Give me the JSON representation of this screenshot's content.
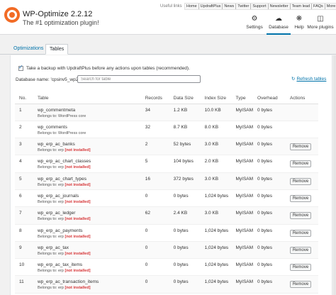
{
  "header": {
    "title": "WP-Optimize 2.2.12",
    "subtitle": "The #1 optimization plugin!",
    "useful_links_label": "Useful links",
    "top_links": [
      "Home",
      "UpdraftPlus",
      "News",
      "Twitter",
      "Support",
      "Newsletter",
      "Team lead",
      "FAQs",
      "More plugins"
    ],
    "nav": {
      "settings": "Settings",
      "database": "Database",
      "help": "Help",
      "more_plugins": "More plugins"
    }
  },
  "tabs": {
    "optimizations": "Optimizations",
    "tables": "Tables"
  },
  "backup_label": "Take a backup with UpdraftPlus before any actions upon tables (recommended).",
  "db_name_label": "Database name: 'cpsinv5_wp226'",
  "search": {
    "placeholder": "Search for table"
  },
  "refresh_label": "Refresh tables",
  "table": {
    "headers": {
      "no": "No.",
      "table": "Table",
      "records": "Records",
      "data_size": "Data Size",
      "index_size": "Index Size",
      "type": "Type",
      "overhead": "Overhead",
      "actions": "Actions"
    },
    "remove_label": "Remove",
    "rows": [
      {
        "no": "1",
        "name": "wp_commentmeta",
        "belongs": "Belongs to: WordPress core",
        "not_installed": "",
        "records": "34",
        "data_size": "1.2 KB",
        "index_size": "10.0 KB",
        "type": "MyISAM",
        "overhead": "0 bytes",
        "removable": false
      },
      {
        "no": "2",
        "name": "wp_comments",
        "belongs": "Belongs to: WordPress core",
        "not_installed": "",
        "records": "32",
        "data_size": "8.7 KB",
        "index_size": "8.0 KB",
        "type": "MyISAM",
        "overhead": "0 bytes",
        "removable": false
      },
      {
        "no": "3",
        "name": "wp_erp_ac_banks",
        "belongs": "Belongs to: erp",
        "not_installed": "[not installed]",
        "records": "2",
        "data_size": "52 bytes",
        "index_size": "3.0 KB",
        "type": "MyISAM",
        "overhead": "0 bytes",
        "removable": true
      },
      {
        "no": "4",
        "name": "wp_erp_ac_chart_classes",
        "belongs": "Belongs to: erp",
        "not_installed": "[not installed]",
        "records": "5",
        "data_size": "104 bytes",
        "index_size": "2.0 KB",
        "type": "MyISAM",
        "overhead": "0 bytes",
        "removable": true
      },
      {
        "no": "5",
        "name": "wp_erp_ac_chart_types",
        "belongs": "Belongs to: erp",
        "not_installed": "[not installed]",
        "records": "16",
        "data_size": "372 bytes",
        "index_size": "3.0 KB",
        "type": "MyISAM",
        "overhead": "0 bytes",
        "removable": true
      },
      {
        "no": "6",
        "name": "wp_erp_ac_journals",
        "belongs": "Belongs to: erp",
        "not_installed": "[not installed]",
        "records": "0",
        "data_size": "0 bytes",
        "index_size": "1,024 bytes",
        "type": "MyISAM",
        "overhead": "0 bytes",
        "removable": true
      },
      {
        "no": "7",
        "name": "wp_erp_ac_ledger",
        "belongs": "Belongs to: erp",
        "not_installed": "[not installed]",
        "records": "62",
        "data_size": "2.4 KB",
        "index_size": "3.0 KB",
        "type": "MyISAM",
        "overhead": "0 bytes",
        "removable": true
      },
      {
        "no": "8",
        "name": "wp_erp_ac_payments",
        "belongs": "Belongs to: erp",
        "not_installed": "[not installed]",
        "records": "0",
        "data_size": "0 bytes",
        "index_size": "1,024 bytes",
        "type": "MyISAM",
        "overhead": "0 bytes",
        "removable": true
      },
      {
        "no": "9",
        "name": "wp_erp_ac_tax",
        "belongs": "Belongs to: erp",
        "not_installed": "[not installed]",
        "records": "0",
        "data_size": "0 bytes",
        "index_size": "1,024 bytes",
        "type": "MyISAM",
        "overhead": "0 bytes",
        "removable": true
      },
      {
        "no": "10",
        "name": "wp_erp_ac_tax_items",
        "belongs": "Belongs to: erp",
        "not_installed": "[not installed]",
        "records": "0",
        "data_size": "0 bytes",
        "index_size": "1,024 bytes",
        "type": "MyISAM",
        "overhead": "0 bytes",
        "removable": true
      },
      {
        "no": "11",
        "name": "wp_erp_ac_transaction_items",
        "belongs": "Belongs to: erp",
        "not_installed": "[not installed]",
        "records": "0",
        "data_size": "0 bytes",
        "index_size": "1,024 bytes",
        "type": "MyISAM",
        "overhead": "0 bytes",
        "removable": true
      }
    ]
  },
  "colors": {
    "accent": "#0073aa",
    "brand": "#f26b25",
    "danger": "#d63638"
  },
  "icons": {
    "settings": "gear-icon",
    "database": "database-icon",
    "help": "help-icon",
    "more_plugins": "plugins-icon",
    "refresh": "refresh-icon",
    "backup_checkbox": "checkbox-icon"
  }
}
